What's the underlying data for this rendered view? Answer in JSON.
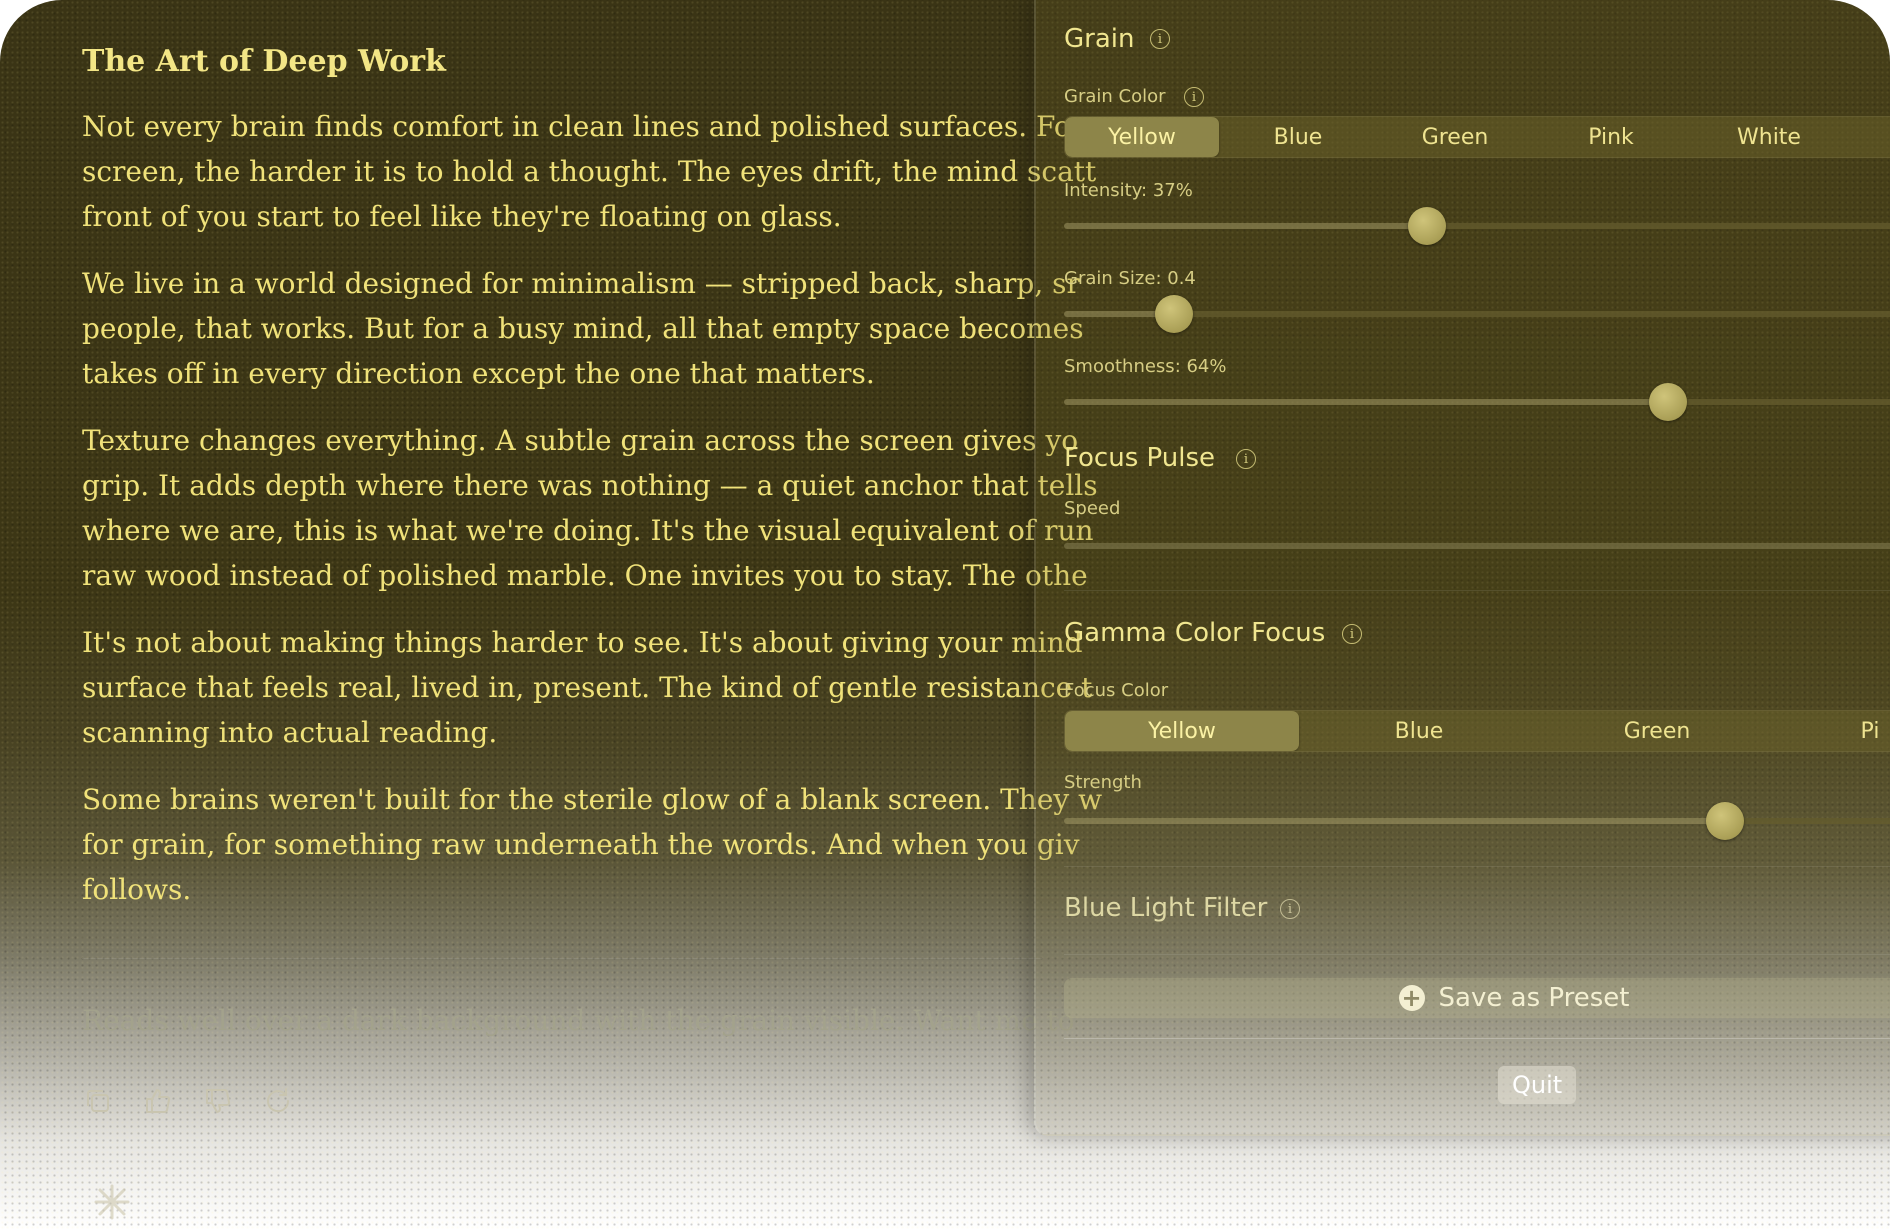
{
  "article": {
    "title": "The Art of Deep Work",
    "paragraphs": [
      [
        "Not every brain finds comfort in clean lines and polished surfaces. For",
        "screen, the harder it is to hold a thought. The eyes drift, the mind scatt",
        "front of you start to feel like they're floating on glass."
      ],
      [
        "We live in a world designed for minimalism — stripped back, sharp, sr",
        "people, that works. But for a busy mind, all that empty space becomes",
        "takes off in every direction except the one that matters."
      ],
      [
        "Texture changes everything. A subtle grain across the screen gives yo",
        "grip. It adds depth where there was nothing — a quiet anchor that tells",
        "where we are, this is what we're doing. It's the visual equivalent of run",
        "raw wood instead of polished marble. One invites you to stay. The othe"
      ],
      [
        "It's not about making things harder to see. It's about giving your mind",
        "surface that feels real, lived in, present. The kind of gentle resistance t",
        "scanning into actual reading."
      ],
      [
        "Some brains weren't built for the sterile glow of a blank screen. They w",
        "for grain, for something raw underneath the words. And when you giv",
        "follows."
      ]
    ],
    "reply": "Reads well over a dark background with the grain visible. Want me to"
  },
  "message_actions": [
    "copy-icon",
    "thumbs-up-icon",
    "thumbs-down-icon",
    "retry-icon"
  ],
  "panel": {
    "grain": {
      "title": "Grain",
      "color_label": "Grain Color",
      "color_options": [
        "Yellow",
        "Blue",
        "Green",
        "Pink",
        "White"
      ],
      "selected_color": "Yellow",
      "intensity_label": "Intensity: 37%",
      "intensity": 0.37,
      "size_label": "Grain Size: 0.4",
      "size": 0.4,
      "smoothness_label": "Smoothness: 64%",
      "smoothness": 0.64
    },
    "focus_pulse": {
      "title": "Focus Pulse",
      "speed_label": "Speed"
    },
    "gamma": {
      "title": "Gamma Color Focus",
      "color_label": "Focus Color",
      "color_options": [
        "Yellow",
        "Blue",
        "Green",
        "Pi"
      ],
      "selected_color": "Yellow",
      "strength_label": "Strength",
      "strength": 0.65
    },
    "blue_light": {
      "title": "Blue Light Filter"
    },
    "save_preset_label": "Save as Preset",
    "quit_label": "Quit"
  },
  "colors": {
    "text_yellow": "#f0e27a",
    "background_dark": "#3a3415",
    "active_segment": "#8d8549"
  }
}
